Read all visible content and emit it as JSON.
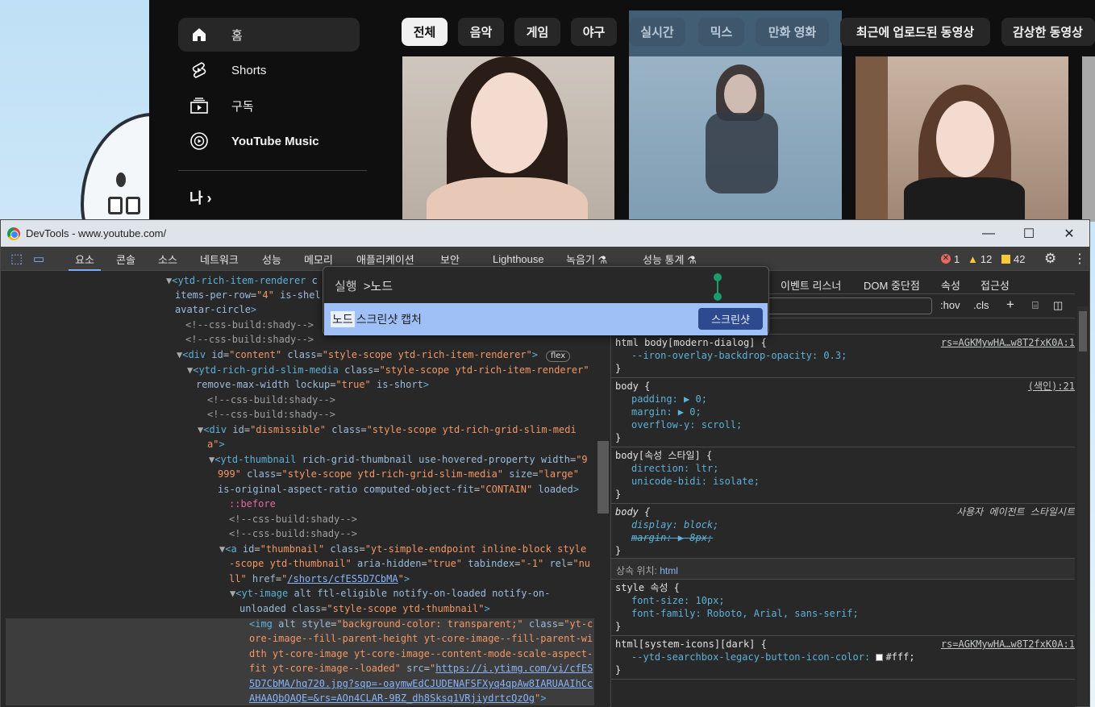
{
  "youtube": {
    "nav": [
      {
        "label": "홈",
        "icon": "home-icon"
      },
      {
        "label": "Shorts",
        "icon": "shorts-icon"
      },
      {
        "label": "구독",
        "icon": "subscriptions-icon"
      },
      {
        "label": "YouTube Music",
        "icon": "youtube-music-icon"
      }
    ],
    "me_label": "나 ›",
    "chips": [
      "전체",
      "음악",
      "게임",
      "야구",
      "실시간",
      "믹스",
      "만화 영화",
      "최근에 업로드된 동영상",
      "감상한 동영상"
    ]
  },
  "devtools": {
    "title": "DevTools - www.youtube.com/",
    "tabs": [
      "요소",
      "콘솔",
      "소스",
      "네트워크",
      "성능",
      "메모리",
      "애플리케이션",
      "보안",
      "Lighthouse",
      "녹음기 ⚗",
      "성능 통계 ⚗"
    ],
    "counts": {
      "errors": "1",
      "warnings": "12",
      "issues": "42"
    },
    "styles_tabs": [
      "이벤트 리스너",
      "DOM 중단점",
      "속성",
      "접근성"
    ],
    "filter_tools": {
      "hov": ":hov",
      "cls": ".cls"
    },
    "command_menu": {
      "prefix": "실행",
      "query": ">노드",
      "item_highlight": "노드",
      "item_rest": " 스크린샷 캡처",
      "button": "스크린샷"
    },
    "inherited_label": "상속 위치:",
    "inherited_tag": "html",
    "styles": {
      "rule0_close": "}",
      "rule1": {
        "selector": "html body[modern-dialog] {",
        "source": "rs=AGKMywHA…w8T2fxK0A:1",
        "decl": "--iron-overlay-backdrop-opacity: 0.3;"
      },
      "rule2": {
        "selector": "body {",
        "source": "(색인):21",
        "decl1": "padding: ▶ 0;",
        "decl2": "margin: ▶ 0;",
        "decl3": "overflow-y: scroll;"
      },
      "rule3": {
        "selector": "body[속성 스타일] {",
        "decl1": "direction: ltr;",
        "decl2": "unicode-bidi: isolate;"
      },
      "rule4": {
        "selector": "body {",
        "source": "사용자 에이전트 스타일시트",
        "decl1": "display: block;",
        "decl2": "margin: ▶ 8px;"
      },
      "rule5": {
        "selector": "style 속성 {",
        "decl1": "font-size: 10px;",
        "decl2": "font-family: Roboto, Arial, sans-serif;"
      },
      "rule6": {
        "selector": "html[system-icons][dark] {",
        "source": "rs=AGKMywHA…w8T2fxK0A:1",
        "decl": "--ytd-searchbox-legacy-button-icon-color: ",
        "value": "#fff;"
      }
    }
  }
}
